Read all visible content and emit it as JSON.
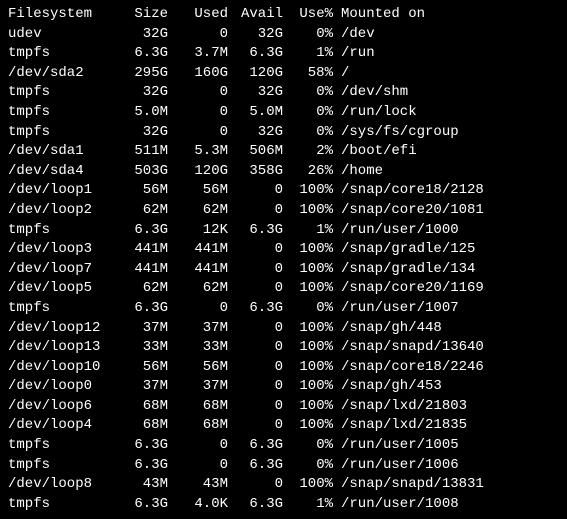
{
  "headers": {
    "filesystem": "Filesystem",
    "size": "Size",
    "used": "Used",
    "avail": "Avail",
    "usep": "Use%",
    "mounted": "Mounted on"
  },
  "rows": [
    {
      "fs": "udev",
      "size": "32G",
      "used": "0",
      "avail": "32G",
      "usep": "0%",
      "mount": "/dev"
    },
    {
      "fs": "tmpfs",
      "size": "6.3G",
      "used": "3.7M",
      "avail": "6.3G",
      "usep": "1%",
      "mount": "/run"
    },
    {
      "fs": "/dev/sda2",
      "size": "295G",
      "used": "160G",
      "avail": "120G",
      "usep": "58%",
      "mount": "/"
    },
    {
      "fs": "tmpfs",
      "size": "32G",
      "used": "0",
      "avail": "32G",
      "usep": "0%",
      "mount": "/dev/shm"
    },
    {
      "fs": "tmpfs",
      "size": "5.0M",
      "used": "0",
      "avail": "5.0M",
      "usep": "0%",
      "mount": "/run/lock"
    },
    {
      "fs": "tmpfs",
      "size": "32G",
      "used": "0",
      "avail": "32G",
      "usep": "0%",
      "mount": "/sys/fs/cgroup"
    },
    {
      "fs": "/dev/sda1",
      "size": "511M",
      "used": "5.3M",
      "avail": "506M",
      "usep": "2%",
      "mount": "/boot/efi"
    },
    {
      "fs": "/dev/sda4",
      "size": "503G",
      "used": "120G",
      "avail": "358G",
      "usep": "26%",
      "mount": "/home"
    },
    {
      "fs": "/dev/loop1",
      "size": "56M",
      "used": "56M",
      "avail": "0",
      "usep": "100%",
      "mount": "/snap/core18/2128"
    },
    {
      "fs": "/dev/loop2",
      "size": "62M",
      "used": "62M",
      "avail": "0",
      "usep": "100%",
      "mount": "/snap/core20/1081"
    },
    {
      "fs": "tmpfs",
      "size": "6.3G",
      "used": "12K",
      "avail": "6.3G",
      "usep": "1%",
      "mount": "/run/user/1000"
    },
    {
      "fs": "/dev/loop3",
      "size": "441M",
      "used": "441M",
      "avail": "0",
      "usep": "100%",
      "mount": "/snap/gradle/125"
    },
    {
      "fs": "/dev/loop7",
      "size": "441M",
      "used": "441M",
      "avail": "0",
      "usep": "100%",
      "mount": "/snap/gradle/134"
    },
    {
      "fs": "/dev/loop5",
      "size": "62M",
      "used": "62M",
      "avail": "0",
      "usep": "100%",
      "mount": "/snap/core20/1169"
    },
    {
      "fs": "tmpfs",
      "size": "6.3G",
      "used": "0",
      "avail": "6.3G",
      "usep": "0%",
      "mount": "/run/user/1007"
    },
    {
      "fs": "/dev/loop12",
      "size": "37M",
      "used": "37M",
      "avail": "0",
      "usep": "100%",
      "mount": "/snap/gh/448"
    },
    {
      "fs": "/dev/loop13",
      "size": "33M",
      "used": "33M",
      "avail": "0",
      "usep": "100%",
      "mount": "/snap/snapd/13640"
    },
    {
      "fs": "/dev/loop10",
      "size": "56M",
      "used": "56M",
      "avail": "0",
      "usep": "100%",
      "mount": "/snap/core18/2246"
    },
    {
      "fs": "/dev/loop0",
      "size": "37M",
      "used": "37M",
      "avail": "0",
      "usep": "100%",
      "mount": "/snap/gh/453"
    },
    {
      "fs": "/dev/loop6",
      "size": "68M",
      "used": "68M",
      "avail": "0",
      "usep": "100%",
      "mount": "/snap/lxd/21803"
    },
    {
      "fs": "/dev/loop4",
      "size": "68M",
      "used": "68M",
      "avail": "0",
      "usep": "100%",
      "mount": "/snap/lxd/21835"
    },
    {
      "fs": "tmpfs",
      "size": "6.3G",
      "used": "0",
      "avail": "6.3G",
      "usep": "0%",
      "mount": "/run/user/1005"
    },
    {
      "fs": "tmpfs",
      "size": "6.3G",
      "used": "0",
      "avail": "6.3G",
      "usep": "0%",
      "mount": "/run/user/1006"
    },
    {
      "fs": "/dev/loop8",
      "size": "43M",
      "used": "43M",
      "avail": "0",
      "usep": "100%",
      "mount": "/snap/snapd/13831"
    },
    {
      "fs": "tmpfs",
      "size": "6.3G",
      "used": "4.0K",
      "avail": "6.3G",
      "usep": "1%",
      "mount": "/run/user/1008"
    }
  ]
}
